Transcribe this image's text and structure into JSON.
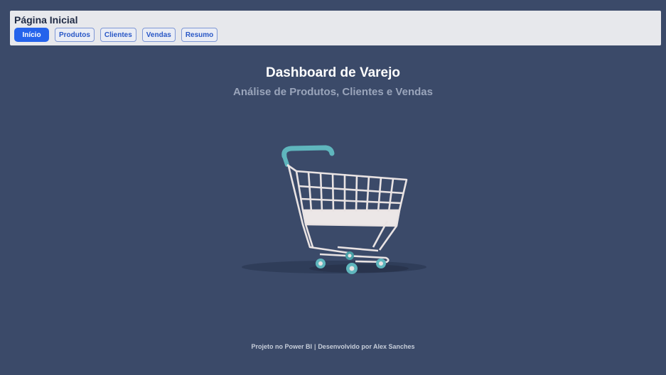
{
  "header": {
    "page_title": "Página Inicial"
  },
  "nav": {
    "items": [
      {
        "label": "Início"
      },
      {
        "label": "Produtos"
      },
      {
        "label": "Clientes"
      },
      {
        "label": "Vendas"
      },
      {
        "label": "Resumo"
      }
    ]
  },
  "main": {
    "title": "Dashboard de Varejo",
    "subtitle": "Análise de Produtos, Clientes e Vendas",
    "image_icon": "shopping-cart-icon"
  },
  "footer": {
    "left": "Projeto no Power BI",
    "separator": "|",
    "right": "Desenvolvido por Alex Sanches"
  },
  "colors": {
    "background": "#3b4a69",
    "topbar": "#e7e8ec",
    "active_button": "#2563eb",
    "button_text": "#2957c6",
    "subtitle": "#9aa5bb",
    "cart_handle": "#5fb6bd"
  }
}
